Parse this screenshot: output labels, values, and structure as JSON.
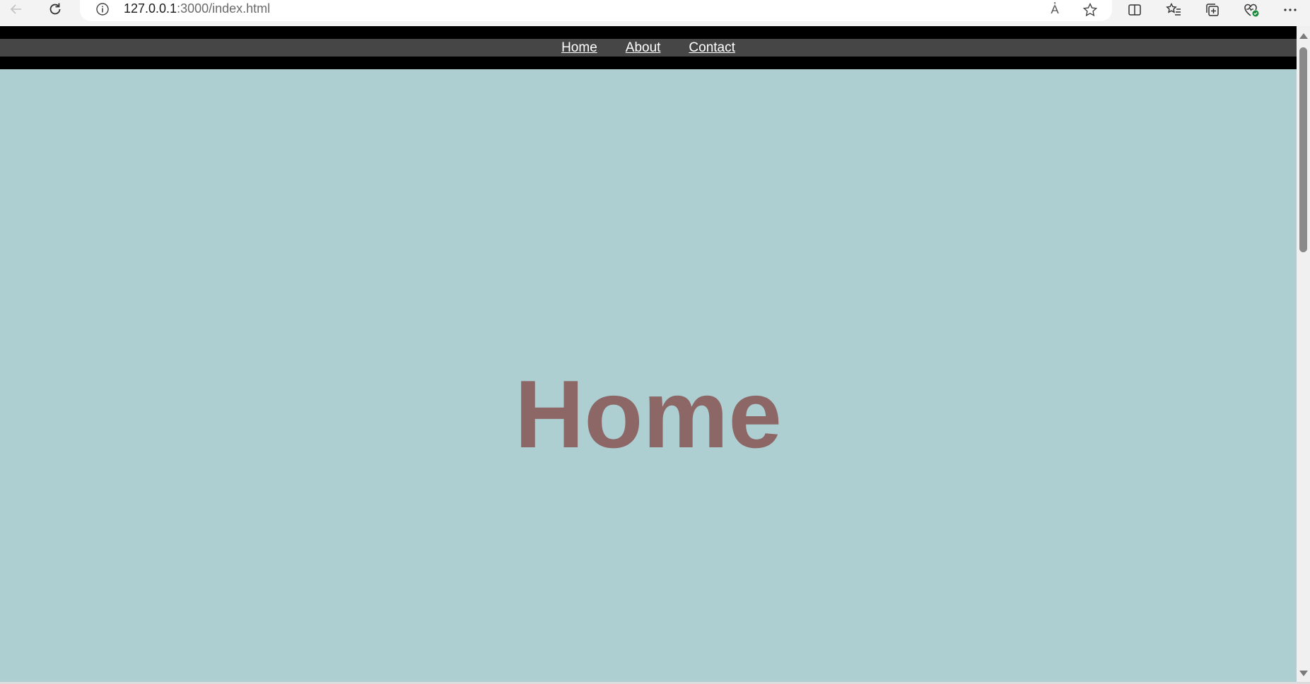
{
  "browser": {
    "url_host": "127.0.0.1",
    "url_path": ":3000/index.html",
    "read_aloud_label": "A҆"
  },
  "icons": {
    "back": "back-arrow-icon",
    "reload": "reload-icon",
    "info": "info-icon",
    "read_aloud": "read-aloud-icon",
    "favorite": "star-icon",
    "split": "split-screen-icon",
    "favorites": "favorites-list-icon",
    "collections": "collections-icon",
    "health": "browser-essentials-icon",
    "more": "more-icon"
  },
  "nav": {
    "links": [
      "Home",
      "About",
      "Contact"
    ]
  },
  "main": {
    "heading": "Home"
  },
  "colors": {
    "page_bg": "#aecfd2",
    "navbar_bg": "#000000",
    "navstrip_bg": "#464646",
    "heading": "#8c6766"
  }
}
